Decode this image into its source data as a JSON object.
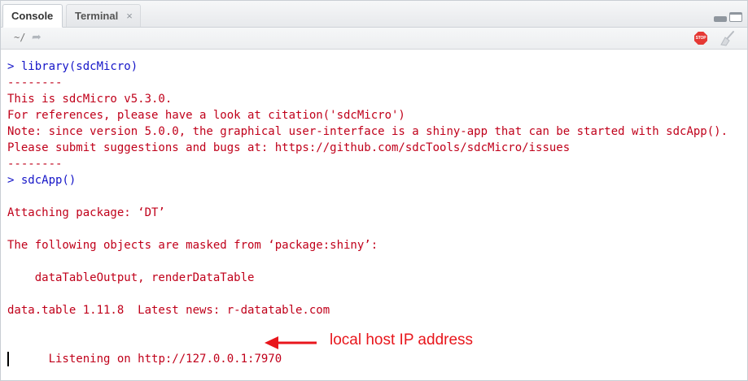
{
  "tabs": [
    {
      "label": "Console",
      "active": true
    },
    {
      "label": "Terminal",
      "active": false,
      "close": "×"
    }
  ],
  "toolbar": {
    "path": "~/",
    "stop_label": "STOP"
  },
  "console": {
    "lines": [
      {
        "type": "cmd",
        "text": "> library(sdcMicro)"
      },
      {
        "type": "out",
        "text": "--------"
      },
      {
        "type": "out",
        "text": "This is sdcMicro v5.3.0."
      },
      {
        "type": "out",
        "text": "For references, please have a look at citation('sdcMicro')"
      },
      {
        "type": "out",
        "text": "Note: since version 5.0.0, the graphical user-interface is a shiny-app that can be started with sdcApp()."
      },
      {
        "type": "out",
        "text": "Please submit suggestions and bugs at: https://github.com/sdcTools/sdcMicro/issues"
      },
      {
        "type": "out",
        "text": "--------"
      },
      {
        "type": "cmd",
        "text": "> sdcApp()"
      },
      {
        "type": "out",
        "text": ""
      },
      {
        "type": "out",
        "text": "Attaching package: ‘DT’"
      },
      {
        "type": "out",
        "text": ""
      },
      {
        "type": "out",
        "text": "The following objects are masked from ‘package:shiny’:"
      },
      {
        "type": "out",
        "text": ""
      },
      {
        "type": "out",
        "text": "    dataTableOutput, renderDataTable"
      },
      {
        "type": "out",
        "text": ""
      },
      {
        "type": "out",
        "text": "data.table 1.11.8  Latest news: r-datatable.com"
      },
      {
        "type": "out",
        "text": ""
      }
    ],
    "listening": "Listening on http://127.0.0.1:7970",
    "annotation": "local host IP address"
  },
  "colors": {
    "command": "#1515c8",
    "output": "#c0001a",
    "annotation": "#e8161c"
  },
  "icons": {
    "nav": "arrow-go-icon",
    "stop": "stop-icon",
    "clear": "broom-icon"
  }
}
